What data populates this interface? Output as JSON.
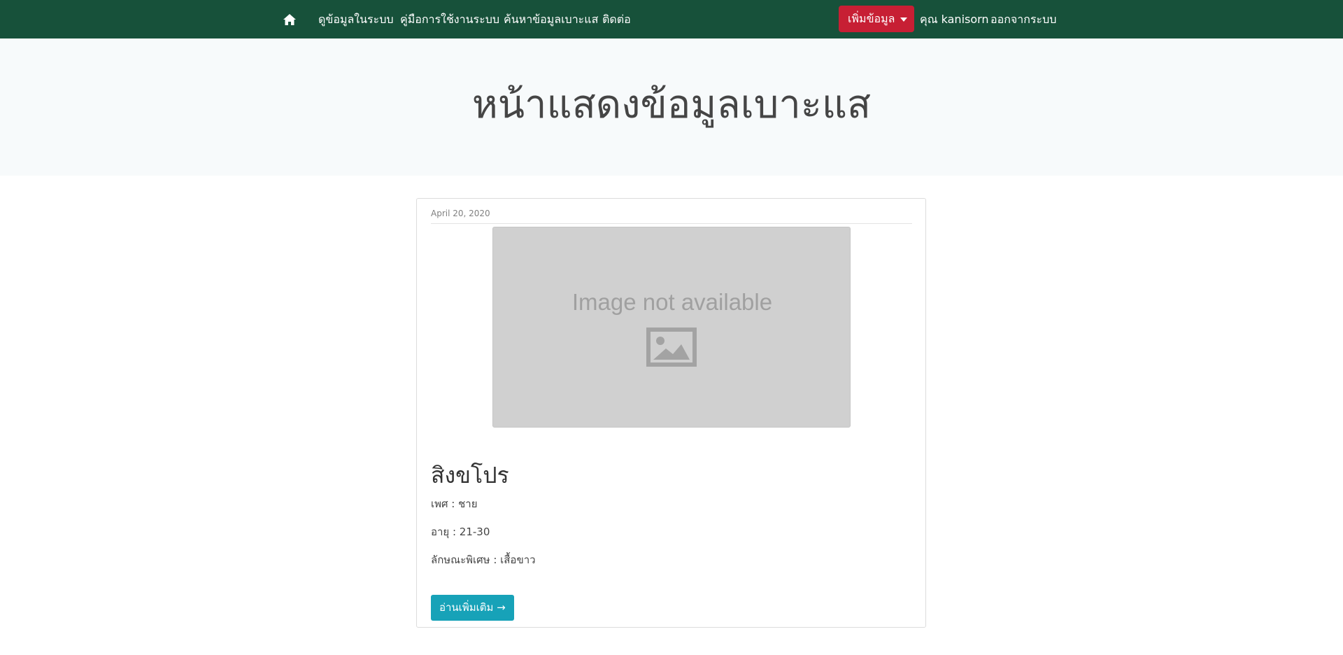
{
  "navbar": {
    "home_icon": "home-icon",
    "links": [
      "ดูข้อมูลในระบบ",
      "คู่มือการใช้งานระบบ",
      "ค้นหาข้อมูลเบาะแส",
      "ติดต่อ"
    ],
    "add_button_label": "เพิ่มข้อมูล",
    "user_label": "คุณ kanisorn",
    "logout_label": "ออกจากระบบ",
    "colors": {
      "navbar_bg": "#17513a",
      "add_button_bg": "#c71f34"
    }
  },
  "hero": {
    "title": "หน้าแสดงข้อมูลเบาะแส"
  },
  "card": {
    "date": "April 20, 2020",
    "image_placeholder_text": "Image not available",
    "image_icon": "image-icon",
    "name": "สิงขโปร",
    "gender": "เพศ : ชาย",
    "age": "อายุ : 21-30",
    "features": "ลักษณะพิเศษ : เสื้อขาว",
    "read_more_label": "อ่านเพิ่มเติม →",
    "colors": {
      "read_more_bg": "#17a2b8"
    }
  }
}
